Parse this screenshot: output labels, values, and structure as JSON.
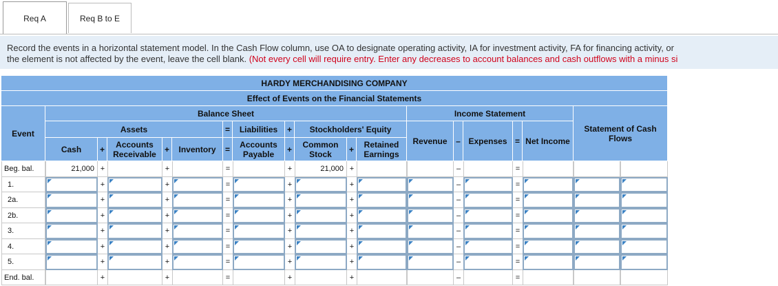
{
  "tabs": [
    {
      "label": "Req A"
    },
    {
      "label": "Req B to E"
    }
  ],
  "instructions": {
    "main": "Record the events in a horizontal statement model. In the Cash Flow column, use OA to designate operating activity, IA for investment activity, FA for financing activity, or",
    "line2_prefix": "the element is not affected by the event, leave the cell blank. ",
    "line2_red": "(Not every cell will require entry. Enter any decreases to account balances and cash outflows with a minus si"
  },
  "table": {
    "company": "HARDY MERCHANDISING COMPANY",
    "subtitle": "Effect of Events on the Financial Statements",
    "balance_sheet": "Balance Sheet",
    "income_statement": "Income Statement",
    "event_header": "Event",
    "assets": "Assets",
    "liabilities": "Liabilities",
    "stockholders_equity": "Stockholders' Equity",
    "cash": "Cash",
    "accounts_receivable": "Accounts Receivable",
    "inventory": "Inventory",
    "accounts_payable": "Accounts Payable",
    "common_stock": "Common Stock",
    "retained_earnings": "Retained Earnings",
    "revenue": "Revenue",
    "expenses": "Expenses",
    "net_income": "Net Income",
    "cash_flows": "Statement of Cash Flows",
    "ops": {
      "plus": "+",
      "eq": "=",
      "minus": "–"
    },
    "rows": [
      {
        "label": "Beg. bal.",
        "cash": "21,000",
        "common_stock": "21,000"
      },
      {
        "label": "1."
      },
      {
        "label": "2a."
      },
      {
        "label": "2b."
      },
      {
        "label": "3."
      },
      {
        "label": "4."
      },
      {
        "label": "5."
      },
      {
        "label": "End. bal."
      }
    ]
  }
}
